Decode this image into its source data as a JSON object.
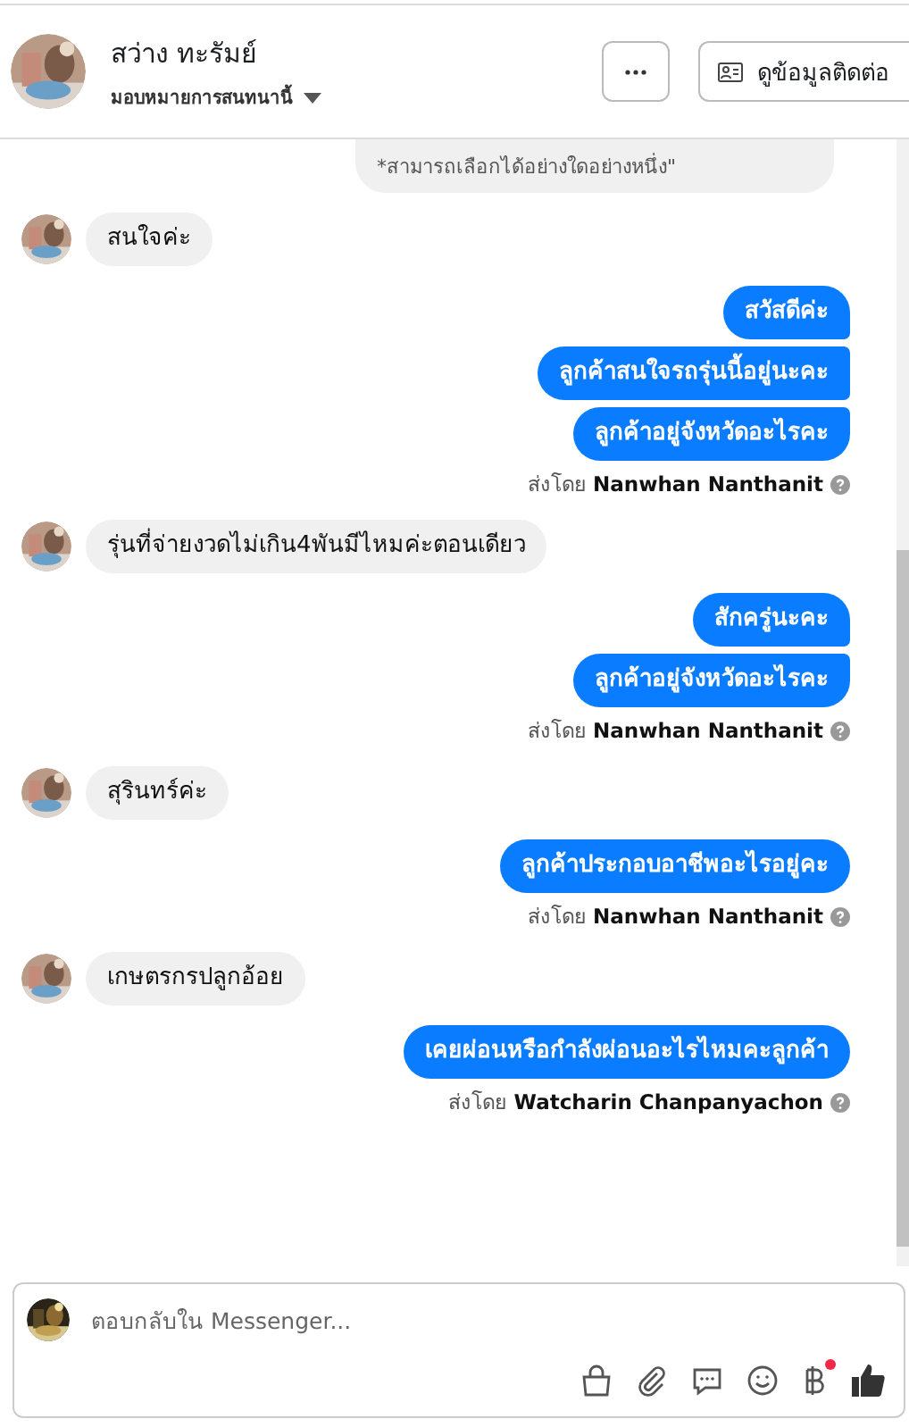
{
  "header": {
    "name": "สว่าง ทะรัมย์",
    "assign_label": "มอบหมายการสนทนานี้",
    "contact_button": "ดูข้อมูลติดต่อ"
  },
  "messages": [
    {
      "kind": "card",
      "texts": [
        "*สามารถเลือกได้อย่างใดอย่างหนึ่ง\""
      ]
    },
    {
      "kind": "incoming",
      "texts": [
        "สนใจค่ะ"
      ]
    },
    {
      "kind": "outgoing",
      "texts": [
        "สวัสดีค่ะ",
        "ลูกค้าสนใจรถรุ่นนี้อยู่นะคะ",
        "ลูกค้าอยู่จังหวัดอะไรคะ"
      ],
      "sent_by": "ส่งโดย **Nanwhan Nanthanit**"
    },
    {
      "kind": "incoming",
      "texts": [
        "รุ่นที่จ่ายงวดไม่เกิน4พันมีไหมค่ะตอนเดียว"
      ]
    },
    {
      "kind": "outgoing",
      "texts": [
        "สักครู่นะคะ",
        "ลูกค้าอยู่จังหวัดอะไรคะ"
      ],
      "sent_by": "ส่งโดย **Nanwhan Nanthanit**"
    },
    {
      "kind": "incoming",
      "texts": [
        "สุรินทร์ค่ะ"
      ]
    },
    {
      "kind": "outgoing",
      "texts": [
        "ลูกค้าประกอบอาชีพอะไรอยู่คะ"
      ],
      "sent_by": "ส่งโดย **Nanwhan Nanthanit**"
    },
    {
      "kind": "incoming",
      "texts": [
        "เกษตรกรปลูกอ้อย"
      ]
    },
    {
      "kind": "outgoing",
      "texts": [
        "เคยผ่อนหรือกำลังผ่อนอะไรไหมคะลูกค้า"
      ],
      "sent_by": "ส่งโดย **Watcharin Chanpanyachon**"
    }
  ],
  "composer": {
    "placeholder": "ตอบกลับใน Messenger...",
    "payment_notification": true
  }
}
